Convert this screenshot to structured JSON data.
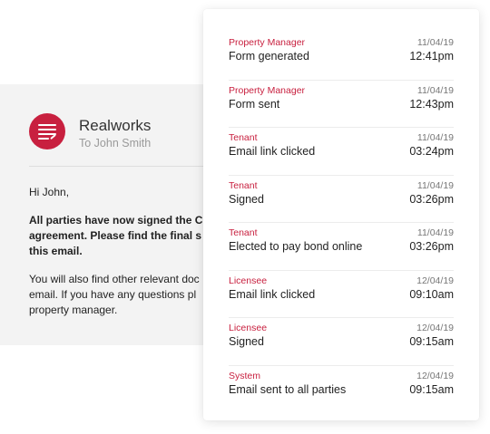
{
  "email": {
    "sender_name": "Realworks",
    "recipient": "To John Smith",
    "greeting": "Hi John,",
    "bold_lines": [
      "All parties have now signed the C",
      "agreement. Please find the final s",
      "this email."
    ],
    "body_lines": [
      "You will also find other relevant doc",
      "email. If you have any questions pl",
      "property manager."
    ]
  },
  "activity": [
    {
      "actor": "Property Manager",
      "date": "11/04/19",
      "action": "Form generated",
      "time": "12:41pm"
    },
    {
      "actor": "Property Manager",
      "date": "11/04/19",
      "action": "Form sent",
      "time": "12:43pm"
    },
    {
      "actor": "Tenant",
      "date": "11/04/19",
      "action": "Email link clicked",
      "time": "03:24pm"
    },
    {
      "actor": "Tenant",
      "date": "11/04/19",
      "action": "Signed",
      "time": "03:26pm"
    },
    {
      "actor": "Tenant",
      "date": "11/04/19",
      "action": "Elected to pay bond online",
      "time": "03:26pm"
    },
    {
      "actor": "Licensee",
      "date": "12/04/19",
      "action": "Email link clicked",
      "time": "09:10am"
    },
    {
      "actor": "Licensee",
      "date": "12/04/19",
      "action": "Signed",
      "time": "09:15am"
    },
    {
      "actor": "System",
      "date": "12/04/19",
      "action": "Email sent to all parties",
      "time": "09:15am"
    }
  ],
  "colors": {
    "brand": "#c8203f",
    "email_background": "#f3f3f3"
  },
  "icons": {
    "logo": "realworks-logo-icon"
  }
}
